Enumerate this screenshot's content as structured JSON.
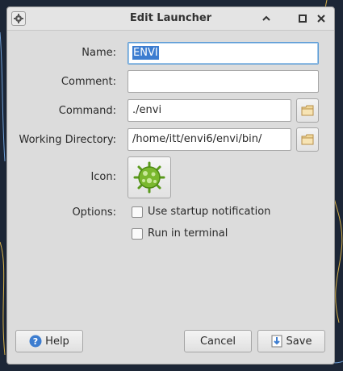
{
  "window": {
    "title": "Edit Launcher",
    "controls": [
      "chevron-up-icon",
      "maximize-icon",
      "close-icon"
    ]
  },
  "form": {
    "name_label": "Name:",
    "name_value": "ENVI",
    "comment_label": "Comment:",
    "comment_value": "",
    "command_label": "Command:",
    "command_value": "./envi",
    "workdir_label": "Working Directory:",
    "workdir_value": "/home/itt/envi6/envi/bin/",
    "icon_label": "Icon:",
    "options_label": "Options:",
    "options": [
      {
        "label": "Use startup notification",
        "checked": false
      },
      {
        "label": "Run in terminal",
        "checked": false
      }
    ]
  },
  "buttons": {
    "help": "Help",
    "cancel": "Cancel",
    "save": "Save"
  },
  "colors": {
    "accent": "#3d7dd0",
    "desktop": "#1c2636",
    "launcher_icon": "#7ab82e"
  }
}
